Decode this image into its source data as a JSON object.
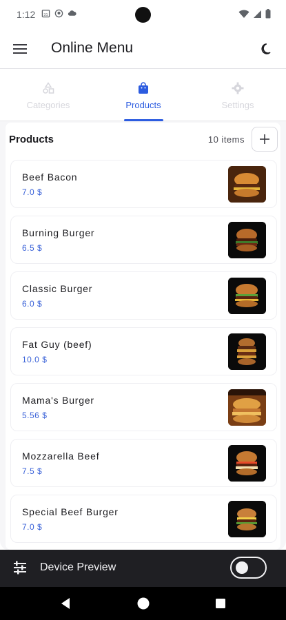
{
  "status_bar": {
    "time": "1:12"
  },
  "app_bar": {
    "title": "Online Menu"
  },
  "tabs": [
    {
      "label": "Categories",
      "icon": "shapes-icon",
      "active": false
    },
    {
      "label": "Products",
      "icon": "shopping-bag-icon",
      "active": true
    },
    {
      "label": "Settings",
      "icon": "gear-icon",
      "active": false
    }
  ],
  "list": {
    "title": "Products",
    "count": "10 items",
    "add_icon": "plus-icon"
  },
  "products": [
    {
      "name": "Beef Bacon",
      "price": "7.0 $",
      "image": "burger-photo-brown"
    },
    {
      "name": "Burning Burger",
      "price": "6.5 $",
      "image": "burger-photo-dark"
    },
    {
      "name": "Classic Burger",
      "price": "6.0 $",
      "image": "burger-photo-dark"
    },
    {
      "name": "Fat Guy (beef)",
      "price": "10.0 $",
      "image": "burger-photo-dark"
    },
    {
      "name": "Mama's Burger",
      "price": "5.56 $",
      "image": "burger-photo-brown"
    },
    {
      "name": "Mozzarella Beef",
      "price": "7.5 $",
      "image": "burger-photo-dark"
    },
    {
      "name": "Special Beef Burger",
      "price": "7.0 $",
      "image": "burger-photo-dark"
    }
  ],
  "device_preview": {
    "label": "Device Preview",
    "toggle_on": false
  },
  "colors": {
    "accent": "#2c5ce0",
    "price": "#3a62d8",
    "inactive_tab": "#d6d6dc",
    "preview_bar": "#1f1f23"
  }
}
